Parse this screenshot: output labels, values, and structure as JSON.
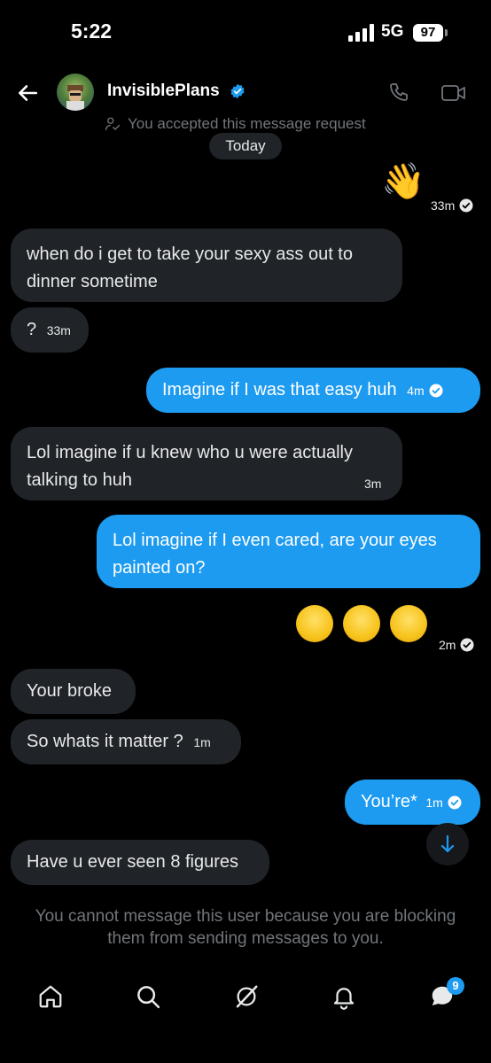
{
  "status_bar": {
    "time": "5:22",
    "network": "5G",
    "battery": "97"
  },
  "header": {
    "name": "InvisiblePlans"
  },
  "notice": {
    "accepted": "You accepted this message request",
    "date": "Today"
  },
  "messages": [
    {
      "dir": "out",
      "text": "👋",
      "time": "33m"
    },
    {
      "dir": "in",
      "text": "when do i get to take your sexy ass out to dinner sometime"
    },
    {
      "dir": "in",
      "text": "?",
      "time": "33m"
    },
    {
      "dir": "out",
      "text": "Imagine if I was that easy huh",
      "time": "4m"
    },
    {
      "dir": "in",
      "text": "Lol imagine if u knew who u were actually talking to huh",
      "time": "3m"
    },
    {
      "dir": "out",
      "text": "Lol imagine if I even cared, are your eyes painted on?"
    },
    {
      "dir": "out",
      "text": "😂😂😂",
      "time": "2m"
    },
    {
      "dir": "in",
      "text": "Your broke"
    },
    {
      "dir": "in",
      "text": "So whats it matter ?",
      "time": "1m"
    },
    {
      "dir": "out",
      "text": "You’re*",
      "time": "1m"
    },
    {
      "dir": "in",
      "text": "Have u ever seen 8 figures"
    }
  ],
  "footer": {
    "blocked_notice": "You cannot message this user because you are blocking them from sending messages to you."
  },
  "nav": {
    "messages_badge": "9"
  },
  "colors": {
    "accent": "#1d9bf0",
    "incoming_bubble": "#202327",
    "muted": "#71767b"
  }
}
